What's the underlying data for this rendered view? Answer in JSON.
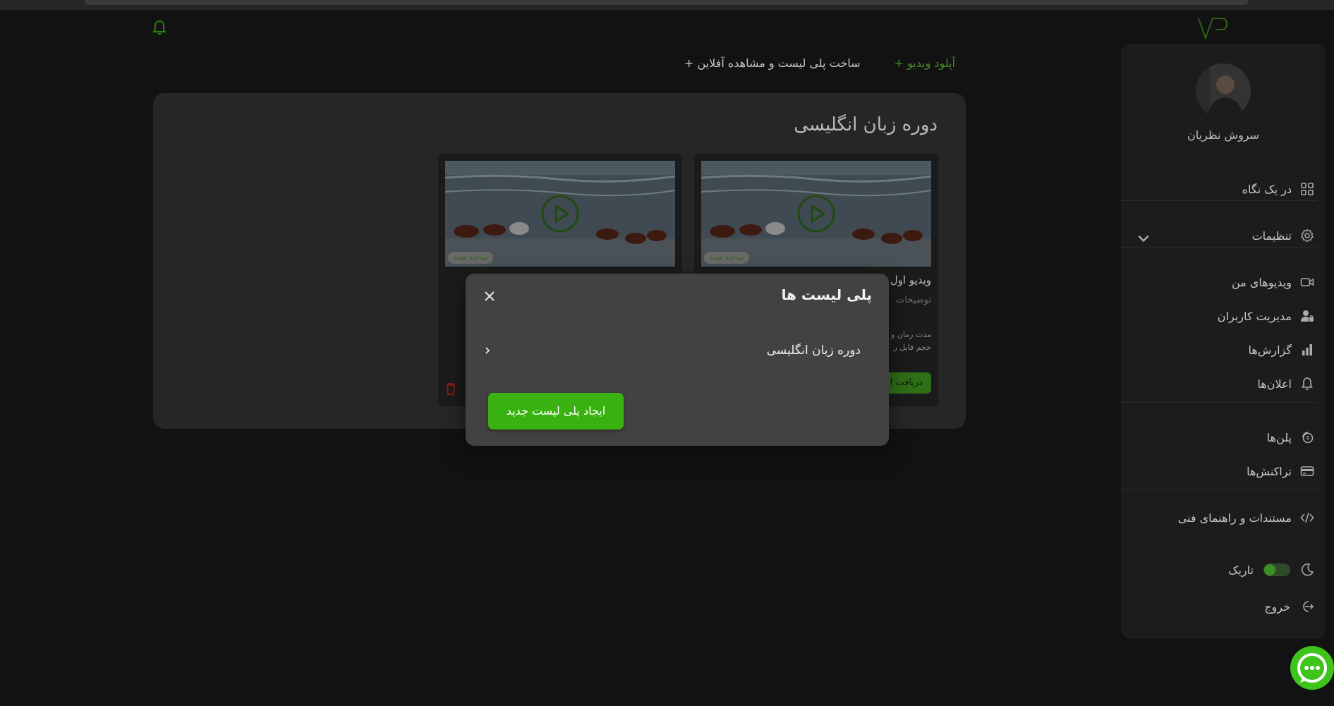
{
  "header": {
    "upload_label": "+ آپلود ویدیو",
    "playlist_label": "+ ساخت پلی لیست و مشاهده آفلاین"
  },
  "sidebar": {
    "user_name": "سروش نظریان",
    "items": [
      {
        "label": "در یک نگاه",
        "icon": "grid-icon"
      },
      {
        "label": "تنظیمات",
        "icon": "gear-icon"
      },
      {
        "label": "ویدیوهای من",
        "icon": "video-icon"
      },
      {
        "label": "مدیریت کاربران",
        "icon": "user-lock-icon"
      },
      {
        "label": "گزارش‌ها",
        "icon": "bar-chart-icon"
      },
      {
        "label": "اعلان‌ها",
        "icon": "bell-icon"
      },
      {
        "label": "پلن‌ها",
        "icon": "plans-icon"
      },
      {
        "label": "تراکنش‌ها",
        "icon": "card-icon"
      },
      {
        "label": "مستندات و راهنمای فنی",
        "icon": "code-icon"
      }
    ],
    "theme_label": "تاریک",
    "logout_label": "خروج"
  },
  "panel": {
    "title": "دوره زبان انگلیسی",
    "cards": [
      {
        "badge": "ساخته شده",
        "title": "ویدیو اول",
        "desc": "توضیحات",
        "meta1": "مدت زمان و",
        "meta2": "حجم فایل ر",
        "button": "دریافت ا"
      },
      {
        "badge": "ساخته شده"
      }
    ]
  },
  "modal": {
    "title": "پلی لیست ها",
    "playlists": [
      "دوره زبان انگلیسی"
    ],
    "create_label": "ایجاد پلی لیست جدید"
  },
  "colors": {
    "accent": "#39b211",
    "background": "#121212",
    "panel": "#262626",
    "modal": "#424242"
  }
}
